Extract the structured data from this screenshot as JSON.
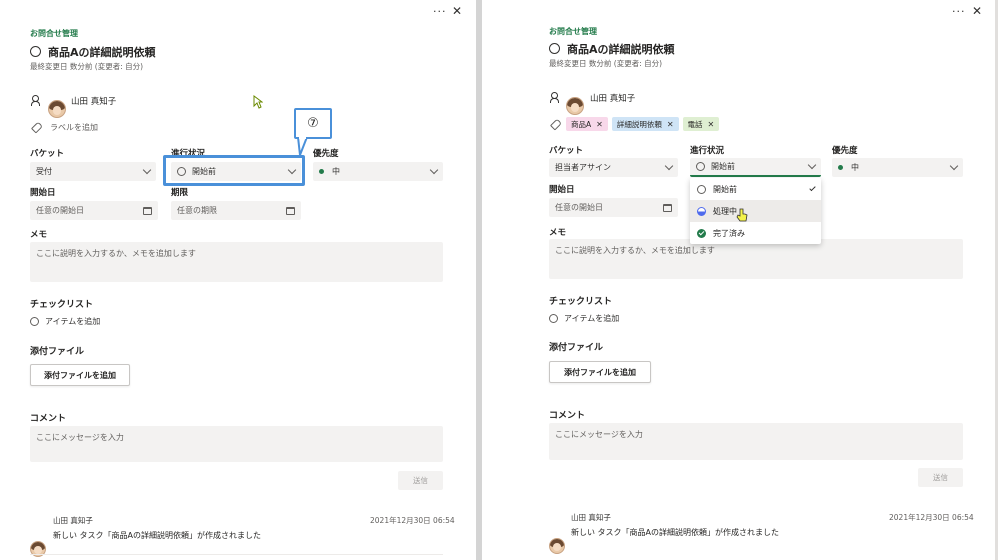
{
  "left": {
    "group_label": "お問合せ管理",
    "task_title": "商品Aの詳細説明依頼",
    "modified": "最終変更日 数分前 (変更者: 自分)",
    "assignee": "山田 真知子",
    "add_label": "ラベルを追加",
    "bucket_label": "バケット",
    "bucket_value": "受付",
    "progress_label": "進行状況",
    "progress_value": "開始前",
    "priority_label": "優先度",
    "priority_value": "中",
    "start_label": "開始日",
    "start_placeholder": "任意の開始日",
    "due_label": "期限",
    "due_placeholder": "任意の期限",
    "memo_label": "メモ",
    "memo_placeholder": "ここに説明を入力するか、メモを追加します",
    "checklist_label": "チェックリスト",
    "add_item": "アイテムを追加",
    "attachments_label": "添付ファイル",
    "add_attachment": "添付ファイルを追加",
    "comments_label": "コメント",
    "comment_placeholder": "ここにメッセージを入力",
    "send": "送信",
    "comment_author": "山田 真知子",
    "comment_time": "2021年12月30日 06:54",
    "comment_text": "新しい タスク「商品Aの詳細説明依頼」が作成されました",
    "callout": "⑦"
  },
  "right": {
    "group_label": "お問合せ管理",
    "task_title": "商品Aの詳細説明依頼",
    "modified": "最終変更日 数分前 (変更者: 自分)",
    "assignee": "山田 真知子",
    "labels": [
      {
        "text": "商品A",
        "bg": "#f8d8ea"
      },
      {
        "text": "詳細説明依頼",
        "bg": "#cfe4f6"
      },
      {
        "text": "電話",
        "bg": "#dfefd2"
      }
    ],
    "bucket_label": "バケット",
    "bucket_value": "担当者アサイン",
    "progress_label": "進行状況",
    "progress_value": "開始前",
    "priority_label": "優先度",
    "priority_value": "中",
    "start_label": "開始日",
    "start_placeholder": "任意の開始日",
    "memo_label": "メモ",
    "memo_placeholder": "ここに説明を入力するか、メモを追加します",
    "checklist_label": "チェックリスト",
    "add_item": "アイテムを追加",
    "attachments_label": "添付ファイル",
    "add_attachment": "添付ファイルを追加",
    "comments_label": "コメント",
    "comment_placeholder": "ここにメッセージを入力",
    "send": "送信",
    "comment_author": "山田 真知子",
    "comment_time": "2021年12月30日 06:54",
    "comment_text": "新しい タスク「商品Aの詳細説明依頼」が作成されました",
    "dropdown_options": [
      "開始前",
      "処理中",
      "完了済み"
    ]
  },
  "icons": {
    "more": "more-horizontal-icon",
    "close": "close-icon"
  },
  "colors": {
    "accent_green": "#237b4b",
    "highlight_blue": "#4a90d9"
  }
}
